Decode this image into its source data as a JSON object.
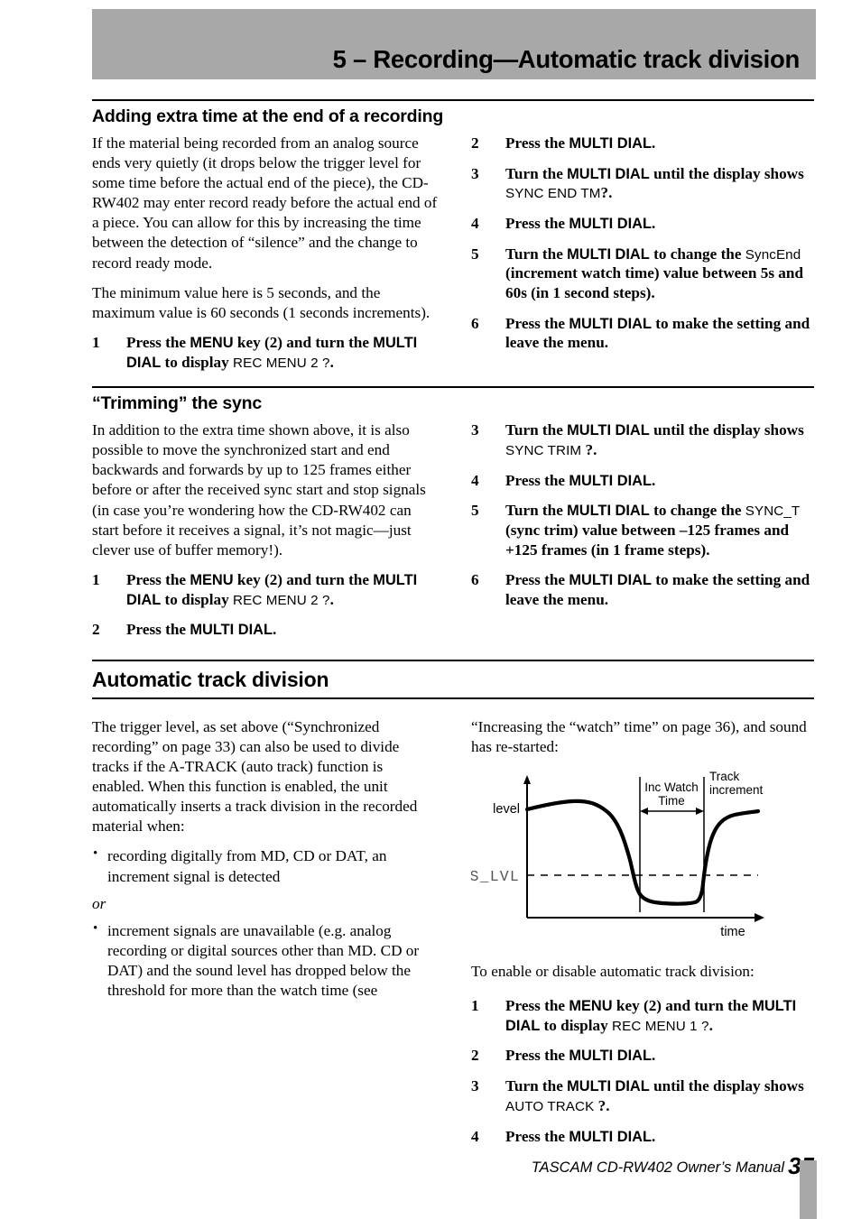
{
  "header": {
    "title": "5 – Recording—Automatic track division"
  },
  "sections": {
    "extra_time": {
      "heading": "Adding extra time at the end of a recording",
      "para1": "If the material being recorded from an analog source ends very quietly (it drops below the trigger level for some time before the actual end of the piece), the CD-RW402 may enter record ready before the actual end of a piece. You can allow for this by increasing the time between the detection of “silence” and the change to record ready mode.",
      "para2": "The minimum value here is 5 seconds, and the maximum value is 60 seconds (1 seconds increments).",
      "steps": [
        {
          "num": "1",
          "bold_a": "Press the ",
          "sans_a": "MENU",
          "bold_b": " key (2) and turn the ",
          "sans_b": "MULTI DIAL",
          "bold_c": " to display ",
          "lcd": "REC MENU 2 ?",
          "bold_d": "."
        },
        {
          "num": "2",
          "bold_a": "Press the ",
          "sans_a": "MULTI DIAL",
          "bold_b": ".",
          "sans_b": "",
          "bold_c": "",
          "lcd": "",
          "bold_d": ""
        },
        {
          "num": "3",
          "bold_a": "Turn the ",
          "sans_a": "MULTI DIAL",
          "bold_b": " until the display shows ",
          "sans_b": "",
          "bold_c": "",
          "lcd": "SYNC END TM",
          "bold_d": "?."
        },
        {
          "num": "4",
          "bold_a": "Press the ",
          "sans_a": "MULTI DIAL",
          "bold_b": ".",
          "sans_b": "",
          "bold_c": "",
          "lcd": "",
          "bold_d": ""
        },
        {
          "num": "5",
          "bold_a": "Turn the ",
          "sans_a": "MULTI DIAL",
          "bold_b": " to change the ",
          "sans_b": "",
          "bold_c": "",
          "lcd": "SyncEnd",
          "bold_d": " (increment watch time) value between 5s and 60s (in 1 second steps)."
        },
        {
          "num": "6",
          "bold_a": "Press the ",
          "sans_a": "MULTI DIAL",
          "bold_b": " to make the setting and leave the menu.",
          "sans_b": "",
          "bold_c": "",
          "lcd": "",
          "bold_d": ""
        }
      ]
    },
    "trimming": {
      "heading": "“Trimming” the sync",
      "para1": "In addition to the extra time shown above, it is also possible to move the synchronized start and end backwards and forwards by up to 125 frames either before or after the received sync start and stop signals (in case you’re wondering how the CD-RW402 can start before it receives a signal, it’s not magic—just clever use of buffer memory!).",
      "steps": [
        {
          "num": "1",
          "bold_a": "Press the ",
          "sans_a": "MENU",
          "bold_b": " key (2) and turn the ",
          "sans_b": "MULTI DIAL",
          "bold_c": " to display ",
          "lcd": "REC MENU 2 ?",
          "bold_d": "."
        },
        {
          "num": "2",
          "bold_a": "Press the ",
          "sans_a": "MULTI DIAL",
          "bold_b": ".",
          "sans_b": "",
          "bold_c": "",
          "lcd": "",
          "bold_d": ""
        },
        {
          "num": "3",
          "bold_a": "Turn the ",
          "sans_a": "MULTI DIAL",
          "bold_b": " until the display shows ",
          "sans_b": "",
          "bold_c": "",
          "lcd": "SYNC TRIM  ",
          "bold_d": "?."
        },
        {
          "num": "4",
          "bold_a": "Press the ",
          "sans_a": "MULTI DIAL",
          "bold_b": ".",
          "sans_b": "",
          "bold_c": "",
          "lcd": "",
          "bold_d": ""
        },
        {
          "num": "5",
          "bold_a": "Turn the ",
          "sans_a": "MULTI DIAL",
          "bold_b": " to change the ",
          "sans_b": "",
          "bold_c": "",
          "lcd": "SYNC_T",
          "bold_d": " (sync trim) value between –125 frames and +125 frames (in 1 frame steps)."
        },
        {
          "num": "6",
          "bold_a": "Press the ",
          "sans_a": "MULTI DIAL",
          "bold_b": " to make the setting and leave the menu.",
          "sans_b": "",
          "bold_c": "",
          "lcd": "",
          "bold_d": ""
        }
      ]
    },
    "auto_track": {
      "heading": "Automatic track division",
      "para1": "The trigger level, as set above (“Synchronized recording” on page 33) can also be used to divide tracks if the A-TRACK (auto track) function is enabled. When this function is enabled, the unit automatically inserts a track division in the recorded material when:",
      "bullet1": "recording digitally from MD, CD or DAT, an increment signal is detected",
      "or_word": "or",
      "bullet2": "increment signals are unavailable (e.g. analog recording or digital sources other than MD. CD or DAT) and the sound level has dropped below the threshold for more than the watch time (see",
      "para_cont": "“Increasing the “watch” time” on page 36), and sound has re-started:",
      "para_enable": "To enable or disable automatic track division:",
      "steps": [
        {
          "num": "1",
          "bold_a": "Press the ",
          "sans_a": "MENU",
          "bold_b": " key (2) and turn the ",
          "sans_b": "MULTI DIAL",
          "bold_c": " to display ",
          "lcd": "REC MENU 1 ?",
          "bold_d": "."
        },
        {
          "num": "2",
          "bold_a": "Press the ",
          "sans_a": "MULTI DIAL",
          "bold_b": ".",
          "sans_b": "",
          "bold_c": "",
          "lcd": "",
          "bold_d": ""
        },
        {
          "num": "3",
          "bold_a": "Turn the ",
          "sans_a": "MULTI DIAL",
          "bold_b": " until the display shows ",
          "sans_b": "",
          "bold_c": "",
          "lcd": "AUTO TRACK ",
          "bold_d": "?."
        },
        {
          "num": "4",
          "bold_a": "Press the ",
          "sans_a": "MULTI DIAL",
          "bold_b": ".",
          "sans_b": "",
          "bold_c": "",
          "lcd": "",
          "bold_d": ""
        }
      ]
    }
  },
  "figure": {
    "y_axis_label": "level",
    "x_axis_label": "time",
    "threshold_label": "S_LVL",
    "annotation_watch": "Inc Watch\nTime",
    "annotation_watch_line1": "Inc Watch",
    "annotation_watch_line2": "Time",
    "annotation_increment_line1": "Track",
    "annotation_increment_line2": "increment"
  },
  "footer": {
    "text": "TASCAM CD-RW402 Owner’s Manual",
    "page": "35"
  },
  "colors": {
    "header_band": "#a8a8a8",
    "edge_tab": "#a8a8a8",
    "text": "#000000"
  }
}
